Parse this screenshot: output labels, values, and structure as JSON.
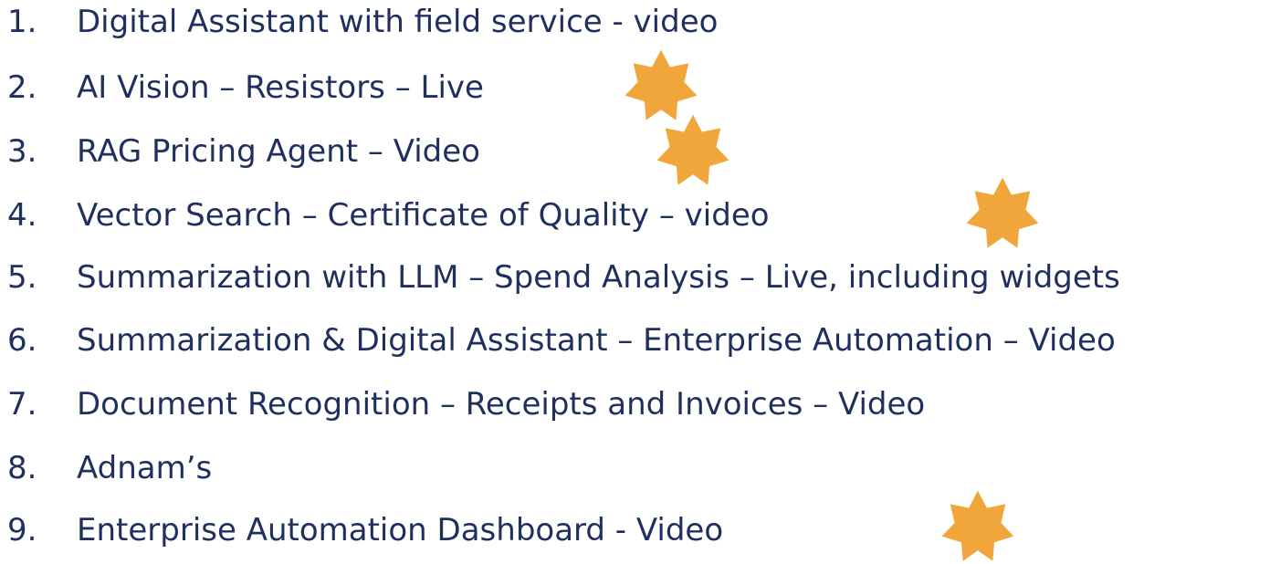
{
  "items": [
    {
      "number": "1.",
      "text": "Digital Assistant with field service - video"
    },
    {
      "number": "2.",
      "text": "AI Vision – Resistors – Live"
    },
    {
      "number": "3.",
      "text": "RAG Pricing Agent – Video"
    },
    {
      "number": "4.",
      "text": "Vector Search – Certificate of Quality – video"
    },
    {
      "number": "5.",
      "text": "Summarization with LLM – Spend Analysis – Live, including widgets"
    },
    {
      "number": "6.",
      "text": "Summarization & Digital Assistant – Enterprise Automation – Video"
    },
    {
      "number": "7.",
      "text": "Document Recognition – Receipts and Invoices – Video"
    },
    {
      "number": "8.",
      "text": "Adnam’s"
    },
    {
      "number": "9.",
      "text": "Enterprise Automation Dashboard - Video"
    }
  ],
  "star_icon": "seven-point-star-icon",
  "colors": {
    "text": "#1f2f5e",
    "star": "#f0a63a"
  }
}
